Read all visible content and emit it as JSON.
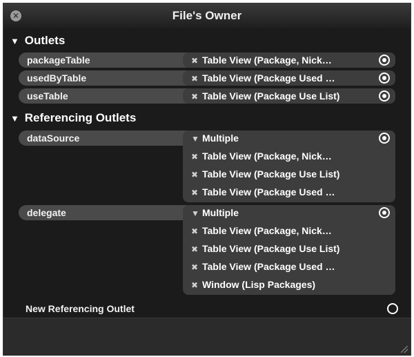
{
  "window": {
    "title": "File's Owner"
  },
  "sections": {
    "outlets": "Outlets",
    "referencing": "Referencing Outlets"
  },
  "outlets": [
    {
      "name": "packageTable",
      "target": "Table View (Package, Nick…"
    },
    {
      "name": "usedByTable",
      "target": "Table View (Package Used …"
    },
    {
      "name": "useTable",
      "target": "Table View (Package Use List)"
    }
  ],
  "referencing": [
    {
      "name": "dataSource",
      "header": "Multiple",
      "targets": [
        "Table View (Package, Nick…",
        "Table View (Package Use List)",
        "Table View (Package Used …"
      ]
    },
    {
      "name": "delegate",
      "header": "Multiple",
      "targets": [
        "Table View (Package, Nick…",
        "Table View (Package Use List)",
        "Table View (Package Used …",
        "Window (Lisp Packages)"
      ]
    }
  ],
  "new_referencing_outlet": "New Referencing Outlet",
  "icons": {
    "close": "close-icon",
    "disclosure": "disclosure-triangle-icon",
    "remove": "remove-x-icon",
    "radio": "connection-circle-icon"
  }
}
